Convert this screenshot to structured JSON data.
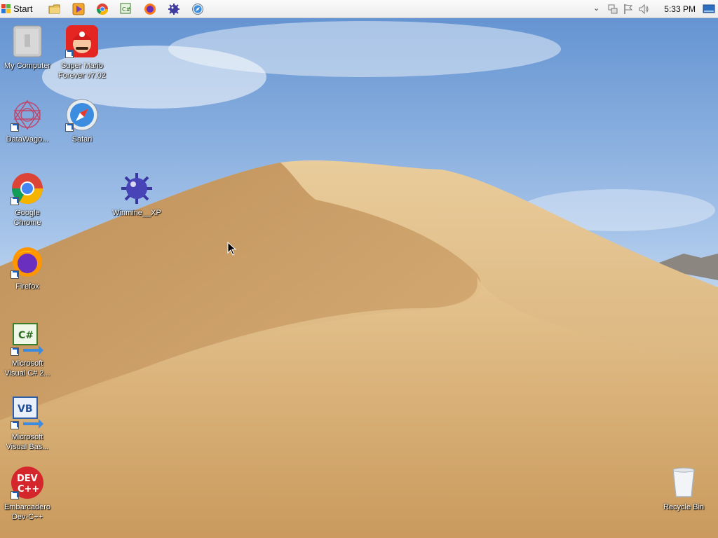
{
  "taskbar": {
    "start_label": "Start",
    "quick_launch": [
      "folder-icon",
      "media-player-icon",
      "chrome-icon",
      "visual-csharp-icon",
      "firefox-icon",
      "winmine-icon",
      "safari-icon"
    ],
    "clock": "5:33 PM"
  },
  "desktop_icons": {
    "my_computer": "My Computer",
    "super_mario": "Super Mario\nForever v7.02",
    "datawago": "DataWago...",
    "safari": "Safari",
    "chrome": "Google\nChrome",
    "winmine": "Winmine__XP",
    "firefox": "Firefox",
    "vcsharp": "Microsoft\nVisual C# 2...",
    "vbasic": "Microsoft\nVisual Bas...",
    "devcpp": "Embarcadero\nDev-C++",
    "recycle_bin": "Recycle Bin"
  },
  "colors": {
    "sky": "#8fb7e6",
    "sand": "#d7b27c",
    "taskbar": "#efefef"
  }
}
